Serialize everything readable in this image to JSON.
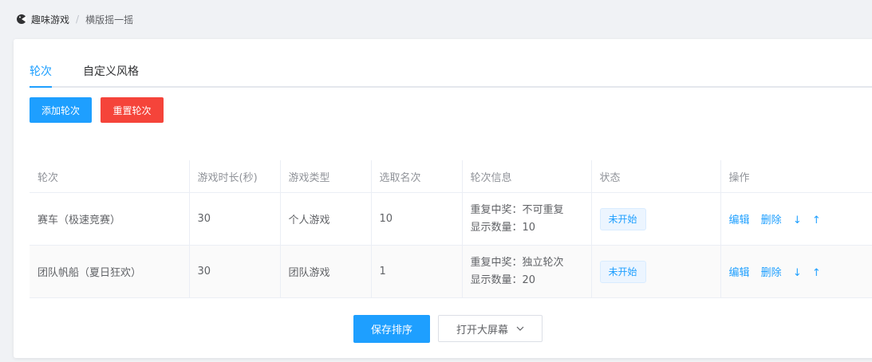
{
  "breadcrumb": {
    "root": "趣味游戏",
    "separator": "/",
    "current": "横版摇一摇"
  },
  "tabs": [
    {
      "label": "轮次",
      "active": true
    },
    {
      "label": "自定义风格",
      "active": false
    }
  ],
  "toolbar": {
    "add_label": "添加轮次",
    "reset_label": "重置轮次"
  },
  "table": {
    "headers": [
      "轮次",
      "游戏时长(秒)",
      "游戏类型",
      "选取名次",
      "轮次信息",
      "状态",
      "操作"
    ],
    "rows": [
      {
        "round": "赛车（极速竞赛）",
        "duration": "30",
        "type": "个人游戏",
        "ranks": "10",
        "info_repeat": "重复中奖：不可重复",
        "info_count": "显示数量：10",
        "status": "未开始",
        "edit": "编辑",
        "delete": "删除",
        "down": "↓",
        "up": "↑"
      },
      {
        "round": "团队帆船（夏日狂欢）",
        "duration": "30",
        "type": "团队游戏",
        "ranks": "1",
        "info_repeat": "重复中奖：独立轮次",
        "info_count": "显示数量：20",
        "status": "未开始",
        "edit": "编辑",
        "delete": "删除",
        "down": "↓",
        "up": "↑"
      }
    ]
  },
  "footer": {
    "save_label": "保存排序",
    "screen_label": "打开大屏幕"
  },
  "colors": {
    "primary": "#1e9fff",
    "danger": "#f5443a"
  }
}
